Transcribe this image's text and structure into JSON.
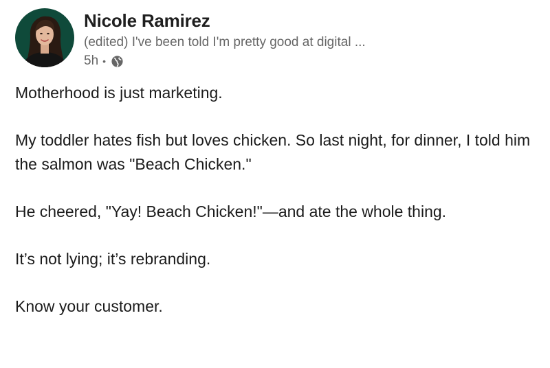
{
  "post": {
    "author": {
      "name": "Nicole Ramirez",
      "headline": "(edited) I've been told I'm pretty good at digital ...",
      "avatar_icon": "profile-photo"
    },
    "timestamp": "5h",
    "separator": "•",
    "visibility_icon": "globe-icon",
    "paragraphs": [
      "Motherhood is just marketing.",
      "My toddler hates fish but loves chicken. So last night, for dinner, I told him the salmon was \"Beach Chicken.\"",
      "He cheered, \"Yay! Beach Chicken!\"—and ate the whole thing.",
      "It’s not lying; it’s rebranding.",
      "Know your customer."
    ]
  },
  "colors": {
    "avatar_bg": "#0f4a3a",
    "text": "#1b1b1b",
    "muted": "#666666"
  }
}
